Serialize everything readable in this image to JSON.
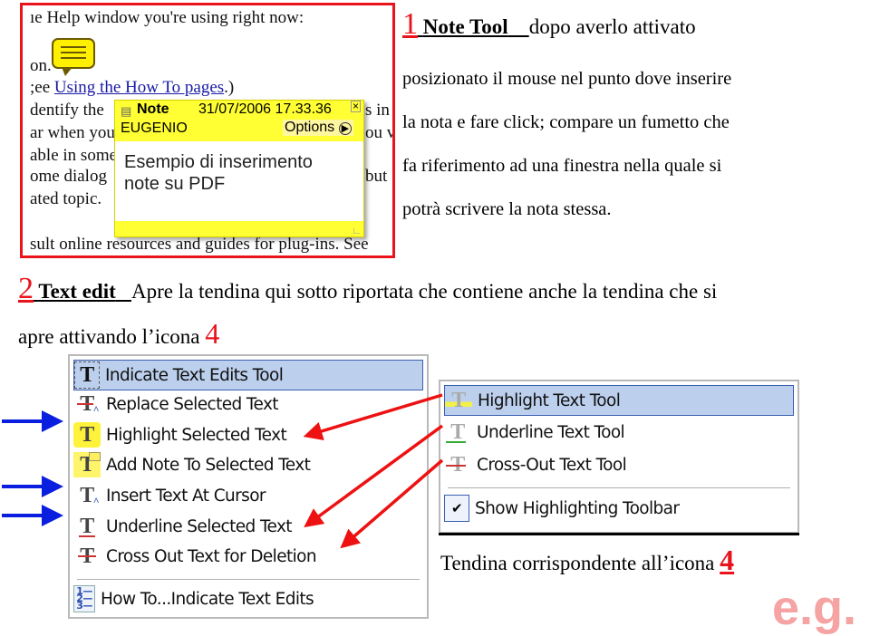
{
  "screenshot_note": {
    "lines": [
      "ıe Help window you're using right now:",
      "on.",
      ";ee ",
      "Using the How To pages",
      ".)",
      "dentify the",
      "ar when you",
      "able in some",
      "ome dialog",
      "ated topic.",
      "sult online resources and guides for plug-ins. See"
    ],
    "right_fragments": [
      "s in",
      "ou v",
      "but"
    ],
    "note_popup": {
      "title": "Note",
      "date": "31/07/2006 17.33.36",
      "author": "EUGENIO",
      "options_label": "Options",
      "close_glyph": "×",
      "body_line1": "Esempio di inserimento",
      "body_line2": "note su PDF"
    }
  },
  "section1": {
    "number": "1",
    "tool": "Note Tool",
    "after": "dopo averlo attivato",
    "paragraph": [
      "posizionato il mouse nel punto dove inserire",
      "la nota e fare click; compare un fumetto  che",
      "fa riferimento ad una finestra nella quale si",
      "potrà scrivere la nota stessa."
    ]
  },
  "section2": {
    "number": "2",
    "tool": "Text edit",
    "text": "Apre la tendina qui sotto riportata che contiene anche la tendina che si",
    "line2": "apre attivando l’icona ",
    "icon_ref": "4"
  },
  "text_edit_menu": {
    "items": [
      {
        "label": "Indicate Text Edits Tool",
        "icon": "indicate-text-edits-icon",
        "selected": true
      },
      {
        "label": "Replace Selected Text",
        "icon": "replace-text-icon"
      },
      {
        "label": "Highlight Selected Text",
        "icon": "highlight-text-icon"
      },
      {
        "label": "Add Note To Selected Text",
        "icon": "add-note-text-icon"
      },
      {
        "label": "Insert Text At Cursor",
        "icon": "insert-text-icon"
      },
      {
        "label": "Underline Selected Text",
        "icon": "underline-text-icon"
      },
      {
        "label": "Cross Out Text for Deletion",
        "icon": "cross-out-text-icon"
      }
    ],
    "howto": {
      "label": "How To...Indicate Text Edits",
      "icon": "numbered-list-icon"
    }
  },
  "highlight_menu": {
    "items": [
      {
        "label": "Highlight Text Tool",
        "icon": "highlight-tool-icon",
        "selected": true
      },
      {
        "label": "Underline Text Tool",
        "icon": "underline-tool-icon"
      },
      {
        "label": "Cross-Out Text Tool",
        "icon": "cross-out-tool-icon"
      }
    ],
    "toggle": {
      "label": "Show Highlighting Toolbar",
      "checked": true
    }
  },
  "caption": {
    "text": "Tendina corrispondente all’icona ",
    "icon_ref": "4"
  },
  "watermark": "e.g.",
  "colors": {
    "accent_red": "#e8131b",
    "arrow_blue": "#0a1ee0",
    "menu_selected": "#bcd0ee",
    "note_yellow": "#ffff33",
    "watermark": "#f5a3a3"
  }
}
